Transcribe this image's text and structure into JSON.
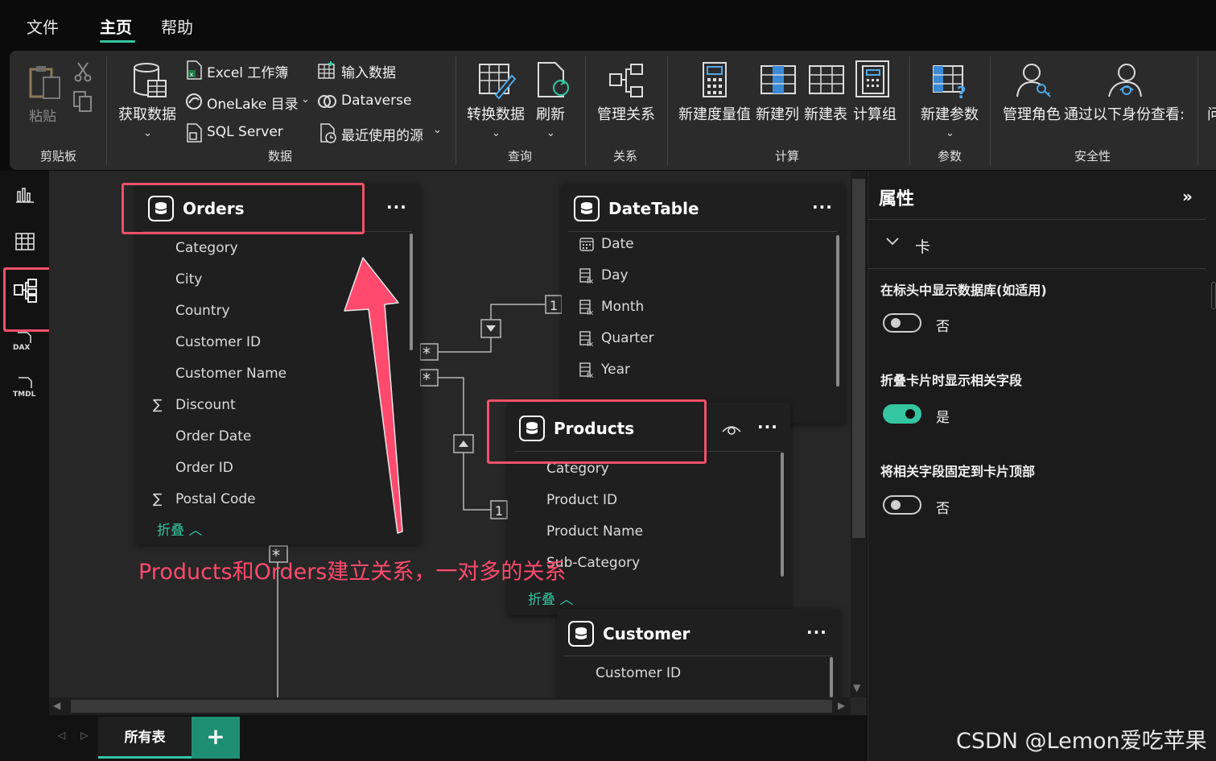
{
  "menu": {
    "file": "文件",
    "home": "主页",
    "help": "帮助"
  },
  "ribbon": {
    "clipboard": {
      "group": "剪贴板",
      "paste": "粘贴"
    },
    "data": {
      "group": "数据",
      "get_data": "获取数据",
      "excel": "Excel 工作簿",
      "onelake": "OneLake 目录",
      "sql": "SQL Server",
      "enter_data": "输入数据",
      "dataverse": "Dataverse",
      "recent": "最近使用的源"
    },
    "query": {
      "group": "查询",
      "transform": "转换数据",
      "refresh": "刷新"
    },
    "relationships": {
      "group": "关系",
      "manage": "管理关系"
    },
    "calculations": {
      "group": "计算",
      "measure": "新建度量值",
      "column": "新建列",
      "table": "新建表",
      "calc_group": "计算组"
    },
    "parameters": {
      "group": "参数",
      "new_param": "新建参数"
    },
    "security": {
      "group": "安全性",
      "manage_roles": "管理角色",
      "view_as": "通过以下身份查看:",
      "more": "问"
    }
  },
  "rail": {
    "icons": [
      "report-view-icon",
      "table-view-icon",
      "model-view-icon",
      "dax-view-icon",
      "tmdl-view-icon"
    ],
    "dax": "DAX",
    "tmdl": "TMDL"
  },
  "tables": {
    "orders": {
      "title": "Orders",
      "fields": [
        "Category",
        "City",
        "Country",
        "Customer ID",
        "Customer Name",
        "Discount",
        "Order Date",
        "Order ID",
        "Postal Code"
      ],
      "collapse": "折叠"
    },
    "datetable": {
      "title": "DateTable",
      "fields": [
        "Date",
        "Day",
        "Month",
        "Quarter",
        "Year"
      ]
    },
    "products": {
      "title": "Products",
      "fields": [
        "Category",
        "Product ID",
        "Product Name",
        "Sub-Category"
      ],
      "collapse": "折叠"
    },
    "customer": {
      "title": "Customer",
      "fields": [
        "Customer ID"
      ]
    }
  },
  "relationship_labels": {
    "one": "1",
    "many": "*"
  },
  "annotation": "Products和Orders建立关系，一对多的关系",
  "panel": {
    "title": "属性",
    "section": "卡",
    "settings": [
      {
        "label": "在标头中显示数据库(如适用)",
        "value": "否",
        "on": false
      },
      {
        "label": "折叠卡片时显示相关字段",
        "value": "是",
        "on": true
      },
      {
        "label": "将相关字段固定到卡片顶部",
        "value": "否",
        "on": false
      }
    ]
  },
  "tabs": {
    "all_tables": "所有表",
    "add": "+"
  },
  "watermark": "CSDN @Lemon爱吃苹果",
  "colors": {
    "accent": "#34c6a0",
    "highlight": "#f0506a",
    "arrow": "#ff4a6e"
  }
}
